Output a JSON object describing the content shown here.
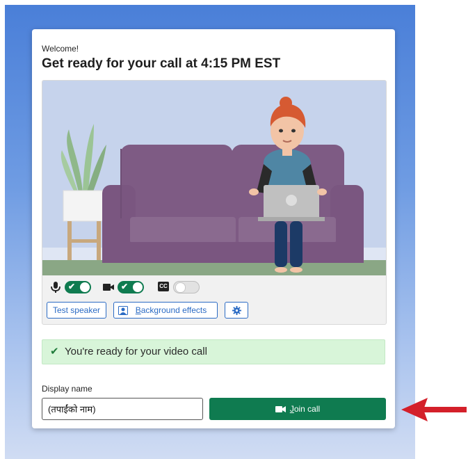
{
  "card": {
    "welcome": "Welcome!",
    "title": "Get ready for your call at 4:15 PM EST"
  },
  "controls": {
    "mic_on": true,
    "camera_on": true,
    "captions_icon": "CC",
    "captions_on": false
  },
  "buttons": {
    "test_speaker": "Test speaker",
    "background_effects_first": "B",
    "background_effects_rest": "ackground effects"
  },
  "status": {
    "ready_text": "You're ready for your video call"
  },
  "display_name": {
    "label": "Display name",
    "placeholder": "(तपाईंको नाम)"
  },
  "join": {
    "first_letter": "J",
    "rest": "oin call"
  },
  "colors": {
    "accent_green": "#0f7b50",
    "link_blue": "#2b6bc4",
    "ready_bg": "#d8f5d9",
    "annotation_arrow": "#d4202a"
  },
  "icons": [
    "microphone-icon",
    "video-camera-icon",
    "closed-captions-icon",
    "background-effects-icon",
    "gear-icon",
    "checkmark-icon",
    "camera-icon",
    "red-arrow"
  ]
}
